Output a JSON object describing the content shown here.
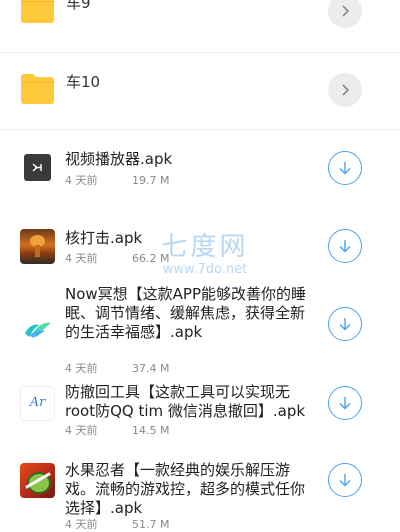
{
  "folders": [
    {
      "name": "车9"
    },
    {
      "name": "车10"
    }
  ],
  "files": [
    {
      "name": "视频播放器.apk",
      "time": "4 天前",
      "size": "19.7 M",
      "icon": "video-player-app-icon"
    },
    {
      "name": "核打击.apk",
      "time": "4 天前",
      "size": "66.2 M",
      "icon": "nuke-game-app-icon"
    },
    {
      "name": "Now冥想【这款APP能够改善你的睡眠、调节情绪、缓解焦虑，获得全新的生活幸福感】.apk",
      "time": "4 天前",
      "size": "37.4 M",
      "icon": "now-meditation-app-icon"
    },
    {
      "name": "防撤回工具【这款工具可以实现无root防QQ tim 微信消息撤回】.apk",
      "time": "4 天前",
      "size": "14.5 M",
      "icon": "anti-recall-app-icon"
    },
    {
      "name": "水果忍者【一款经典的娱乐解压游戏。流畅的游戏控，超多的模式任你选择】.apk",
      "time": "4 天前",
      "size": "51.7 M",
      "icon": "fruit-ninja-app-icon"
    }
  ],
  "watermark": {
    "title": "七度网",
    "url": "www.7do.net"
  },
  "colors": {
    "accent": "#4aa3f0",
    "folder": "#ffc93c",
    "meta": "#8a8a8a"
  }
}
